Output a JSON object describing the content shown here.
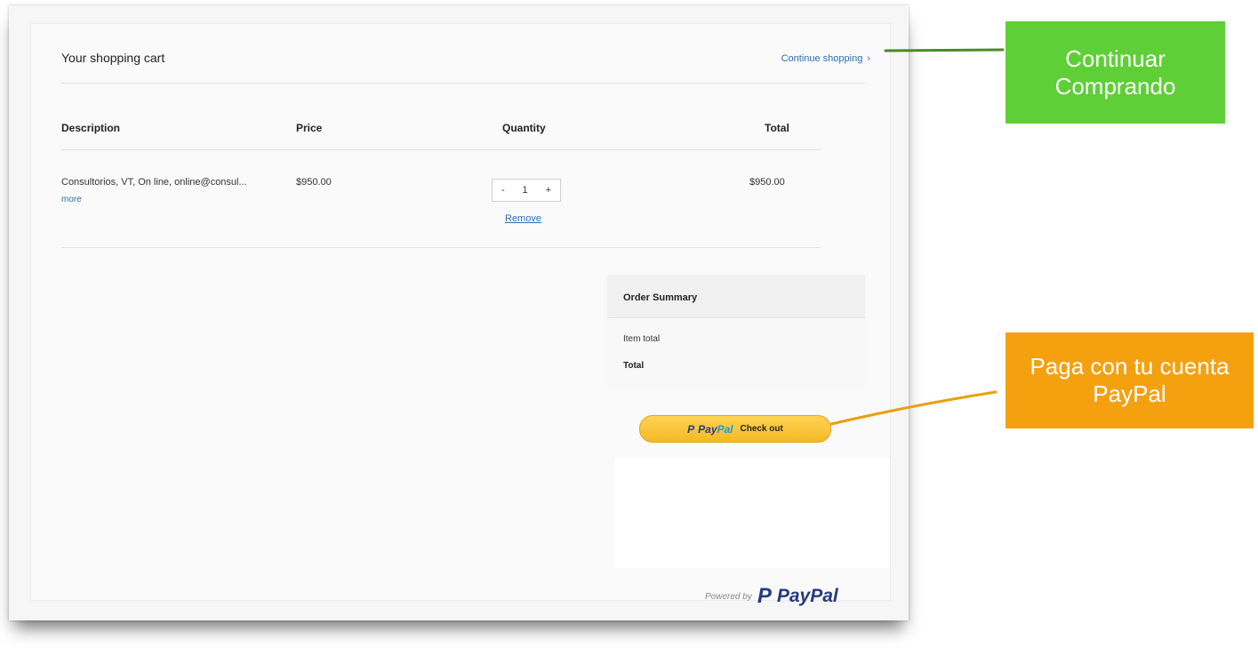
{
  "cart": {
    "title": "Your shopping cart",
    "continue_label": "Continue shopping",
    "continue_chevron": "›",
    "columns": [
      "Description",
      "Price",
      "Quantity",
      "Total"
    ],
    "item": {
      "description": "Consultorios, VT, On line, online@consul...",
      "more": "more",
      "price": "$950.00",
      "quantity_minus": "-",
      "quantity": "1",
      "quantity_plus": "+",
      "remove": "Remove",
      "total": "$950.00"
    }
  },
  "summary": {
    "title": "Order Summary",
    "item_total_label": "Item total",
    "total_label": "Total"
  },
  "paypal_button": {
    "mark": "P",
    "brand_a": "Pay",
    "brand_b": "Pal",
    "label": "Check out"
  },
  "powered": {
    "prefix": "Powered by",
    "mark": "P",
    "brand": "PayPal"
  },
  "callouts": {
    "green": "Continuar Comprando",
    "orange": "Paga con tu cuenta PayPal"
  },
  "colors": {
    "link": "#2c6eb5",
    "paypal_navy": "#253b80",
    "paypal_blue": "#179bd7",
    "paypal_button": "#f5b927",
    "callout_green": "#5ecf36",
    "callout_orange": "#f5a10f"
  }
}
